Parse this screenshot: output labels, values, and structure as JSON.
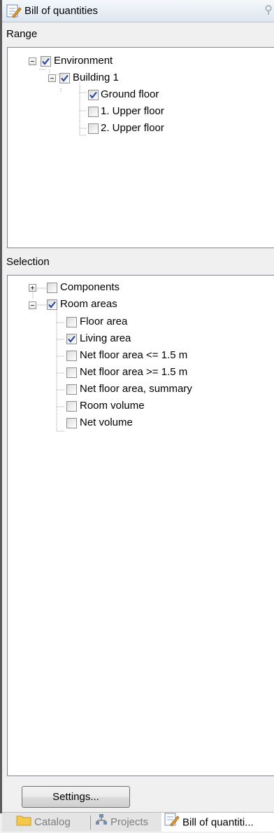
{
  "panel": {
    "title": "Bill of quantities",
    "title_icon": "bill-of-quantities-icon",
    "pin_icon": "pin-icon"
  },
  "range": {
    "label": "Range",
    "nodes": [
      {
        "label": "Environment",
        "checked": true,
        "expander": "minus"
      },
      {
        "label": "Building 1",
        "checked": true,
        "expander": "minus"
      },
      {
        "label": "Ground floor",
        "checked": true
      },
      {
        "label": "1. Upper floor",
        "checked": false
      },
      {
        "label": "2. Upper floor",
        "checked": false
      }
    ]
  },
  "selection": {
    "label": "Selection",
    "nodes": [
      {
        "label": "Components",
        "checked": false,
        "expander": "plus"
      },
      {
        "label": "Room areas",
        "checked": true,
        "expander": "minus"
      },
      {
        "label": "Floor area",
        "checked": false
      },
      {
        "label": "Living area",
        "checked": true
      },
      {
        "label": "Net floor area <= 1.5 m",
        "checked": false
      },
      {
        "label": "Net floor area >= 1.5 m",
        "checked": false
      },
      {
        "label": "Net floor area, summary",
        "checked": false
      },
      {
        "label": "Room volume",
        "checked": false
      },
      {
        "label": "Net volume",
        "checked": false
      }
    ]
  },
  "settings_button": {
    "label": "Settings..."
  },
  "tabs": [
    {
      "label": "Catalog",
      "icon": "folder-icon",
      "active": false
    },
    {
      "label": "Projects",
      "icon": "project-tree-icon",
      "active": false
    },
    {
      "label": "Bill of quantiti...",
      "icon": "bill-of-quantities-icon",
      "active": true
    }
  ],
  "colors": {
    "check": "#2040a0",
    "tree_lines": "#a0a0a0",
    "title_bg": "#dde6f0"
  }
}
